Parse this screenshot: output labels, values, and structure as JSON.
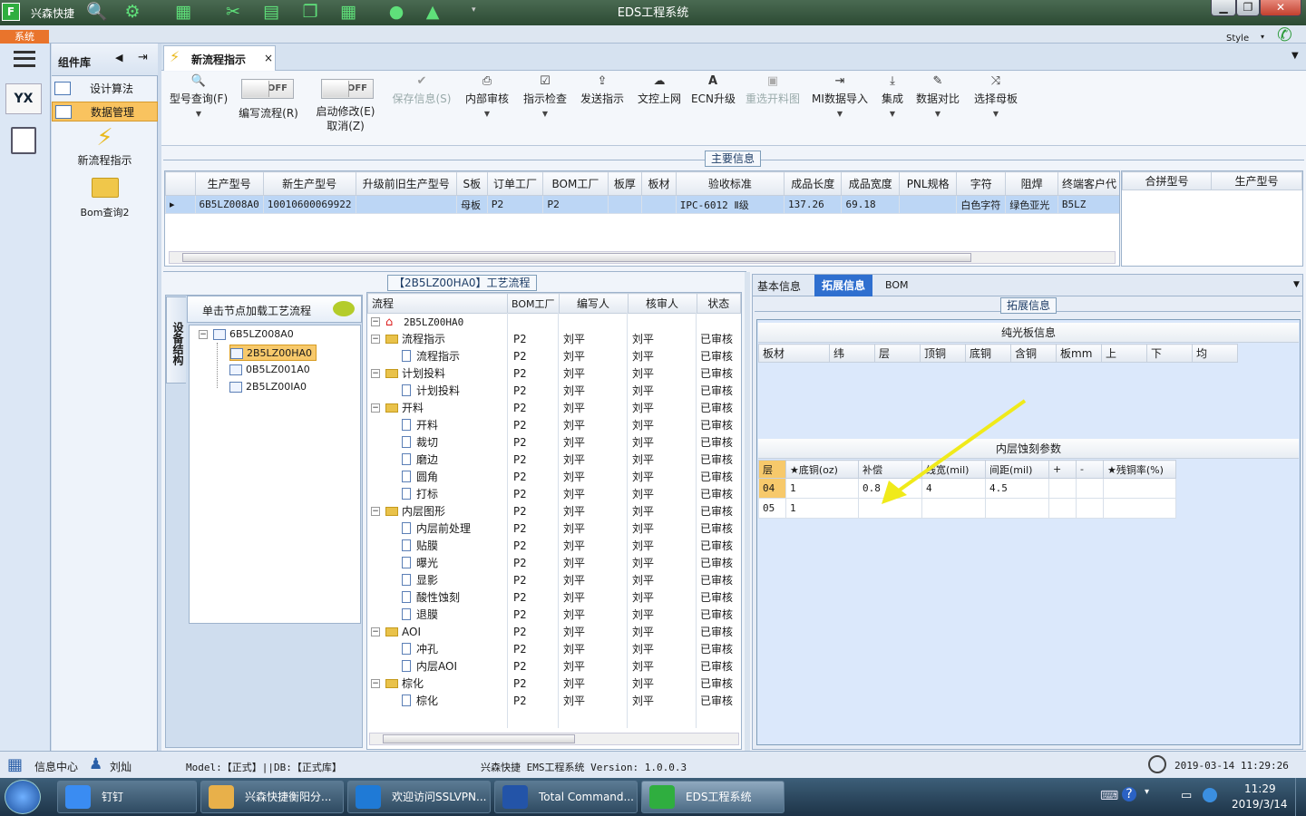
{
  "app": {
    "logo": "F",
    "name": "兴森快捷",
    "title": "EDS工程系统"
  },
  "menubar": {
    "system_tab": "系统",
    "style_label": "Style"
  },
  "colors": {
    "accent": "#2f6fcf",
    "highlight_row": "#bcd6f5",
    "selected_node": "#f7c96b",
    "arrow": "#f0ea1a"
  },
  "complib": {
    "title": "组件库",
    "items": [
      {
        "label": "设计算法"
      },
      {
        "label": "数据管理"
      }
    ],
    "large_items": [
      {
        "label": "新流程指示"
      },
      {
        "label": "Bom查询2"
      }
    ]
  },
  "doc_tab": {
    "label": "新流程指示",
    "close": "×"
  },
  "ribbon": {
    "model_query": "型号查询(F)",
    "toggle1": {
      "state": "OFF",
      "label": "编写流程(R)"
    },
    "toggle2": {
      "state": "OFF",
      "label": "启动修改(E)",
      "sub": "取消(Z)"
    },
    "buttons": [
      {
        "label": "保存信息(S)",
        "icon": "✔"
      },
      {
        "label": "内部审核",
        "icon": "⎙"
      },
      {
        "label": "指示检查",
        "icon": "☑"
      },
      {
        "label": "发送指示",
        "icon": "⇪"
      },
      {
        "label": "文控上网",
        "icon": "☁"
      },
      {
        "label": "ECN升级",
        "icon": "A"
      },
      {
        "label": "重选开料图",
        "icon": "▣"
      },
      {
        "label": "MI数据导入",
        "icon": "⇥"
      },
      {
        "label": "集成",
        "icon": "⤓"
      },
      {
        "label": "数据对比",
        "icon": "✎"
      },
      {
        "label": "选择母板",
        "icon": "⤨"
      }
    ]
  },
  "main_info": {
    "section_label": "主要信息",
    "columns": [
      "生产型号",
      "新生产型号",
      "升级前旧生产型号",
      "S板",
      "订单工厂",
      "BOM工厂",
      "板厚",
      "板材",
      "验收标准",
      "成品长度",
      "成品宽度",
      "PNL规格",
      "字符",
      "阻焊",
      "终端客户代"
    ],
    "row": [
      "6B5LZ008A0",
      "10010600069922",
      "",
      "母板",
      "P2",
      "P2",
      "",
      "",
      "IPC-6012 Ⅱ级",
      "137.26",
      "69.18",
      "",
      "白色字符",
      "绿色亚光",
      "B5LZ"
    ],
    "merge_columns": [
      "合拼型号",
      "生产型号"
    ]
  },
  "process": {
    "section_label": "【2B5LZ00HA0】工艺流程",
    "side_tab": "设备结构",
    "load_hint": "单击节点加载工艺流程",
    "tree": [
      {
        "label": "6B5LZ008A0"
      },
      {
        "label": "2B5LZ00HA0"
      },
      {
        "label": "0B5LZ001A0"
      },
      {
        "label": "2B5LZ00IA0"
      }
    ],
    "columns": [
      "流程",
      "BOM工厂",
      "编写人",
      "核审人",
      "状态"
    ],
    "root": "2B5LZ00HA0",
    "rows": [
      {
        "name": "流程指示",
        "folder": true,
        "bom": "P2",
        "writer": "刘平",
        "reviewer": "刘平",
        "status": "已审核"
      },
      {
        "name": "流程指示",
        "folder": false,
        "bom": "P2",
        "writer": "刘平",
        "reviewer": "刘平",
        "status": "已审核"
      },
      {
        "name": "计划投料",
        "folder": true,
        "bom": "P2",
        "writer": "刘平",
        "reviewer": "刘平",
        "status": "已审核"
      },
      {
        "name": "计划投料",
        "folder": false,
        "bom": "P2",
        "writer": "刘平",
        "reviewer": "刘平",
        "status": "已审核"
      },
      {
        "name": "开料",
        "folder": true,
        "bom": "P2",
        "writer": "刘平",
        "reviewer": "刘平",
        "status": "已审核"
      },
      {
        "name": "开料",
        "folder": false,
        "bom": "P2",
        "writer": "刘平",
        "reviewer": "刘平",
        "status": "已审核"
      },
      {
        "name": "裁切",
        "folder": false,
        "bom": "P2",
        "writer": "刘平",
        "reviewer": "刘平",
        "status": "已审核"
      },
      {
        "name": "磨边",
        "folder": false,
        "bom": "P2",
        "writer": "刘平",
        "reviewer": "刘平",
        "status": "已审核"
      },
      {
        "name": "圆角",
        "folder": false,
        "bom": "P2",
        "writer": "刘平",
        "reviewer": "刘平",
        "status": "已审核"
      },
      {
        "name": "打标",
        "folder": false,
        "bom": "P2",
        "writer": "刘平",
        "reviewer": "刘平",
        "status": "已审核"
      },
      {
        "name": "内层图形",
        "folder": true,
        "bom": "P2",
        "writer": "刘平",
        "reviewer": "刘平",
        "status": "已审核"
      },
      {
        "name": "内层前处理",
        "folder": false,
        "bom": "P2",
        "writer": "刘平",
        "reviewer": "刘平",
        "status": "已审核"
      },
      {
        "name": "贴膜",
        "folder": false,
        "bom": "P2",
        "writer": "刘平",
        "reviewer": "刘平",
        "status": "已审核"
      },
      {
        "name": "曝光",
        "folder": false,
        "bom": "P2",
        "writer": "刘平",
        "reviewer": "刘平",
        "status": "已审核"
      },
      {
        "name": "显影",
        "folder": false,
        "bom": "P2",
        "writer": "刘平",
        "reviewer": "刘平",
        "status": "已审核"
      },
      {
        "name": "酸性蚀刻",
        "folder": false,
        "bom": "P2",
        "writer": "刘平",
        "reviewer": "刘平",
        "status": "已审核"
      },
      {
        "name": "退膜",
        "folder": false,
        "bom": "P2",
        "writer": "刘平",
        "reviewer": "刘平",
        "status": "已审核"
      },
      {
        "name": "AOI",
        "folder": true,
        "bom": "P2",
        "writer": "刘平",
        "reviewer": "刘平",
        "status": "已审核"
      },
      {
        "name": "冲孔",
        "folder": false,
        "bom": "P2",
        "writer": "刘平",
        "reviewer": "刘平",
        "status": "已审核"
      },
      {
        "name": "内层AOI",
        "folder": false,
        "bom": "P2",
        "writer": "刘平",
        "reviewer": "刘平",
        "status": "已审核"
      },
      {
        "name": "棕化",
        "folder": true,
        "bom": "P2",
        "writer": "刘平",
        "reviewer": "刘平",
        "status": "已审核"
      },
      {
        "name": "棕化",
        "folder": false,
        "bom": "P2",
        "writer": "刘平",
        "reviewer": "刘平",
        "status": "已审核"
      }
    ]
  },
  "right": {
    "tabs": [
      "基本信息",
      "拓展信息",
      "BOM"
    ],
    "section_label": "拓展信息",
    "bare_board": {
      "title": "纯光板信息",
      "columns": [
        "板材",
        "纬",
        "层",
        "顶铜",
        "底铜",
        "含铜",
        "板mm",
        "上",
        "下",
        "均"
      ]
    },
    "etch": {
      "title": "内层蚀刻参数",
      "columns": [
        "层",
        "★底铜(oz)",
        "补偿",
        "线宽(mil)",
        "间距(mil)",
        "+",
        "-",
        "★残铜率(%)"
      ],
      "rows": [
        [
          "04",
          "1",
          "0.8",
          "4",
          "4.5",
          "",
          "",
          ""
        ],
        [
          "05",
          "1",
          "",
          "",
          "",
          "",
          "",
          ""
        ]
      ]
    }
  },
  "status": {
    "info_center": "信息中心",
    "user": "刘灿",
    "model_db": "Model:【正式】||DB:【正式库】",
    "version": "兴森快捷  EMS工程系统  Version: 1.0.0.3",
    "datetime": "2019-03-14 11:29:26"
  },
  "taskbar": {
    "tasks": [
      "钉钉",
      "兴森快捷衡阳分...",
      "欢迎访问SSLVPN...",
      "Total Command...",
      "EDS工程系统"
    ],
    "time": "11:29",
    "date": "2019/3/14"
  }
}
